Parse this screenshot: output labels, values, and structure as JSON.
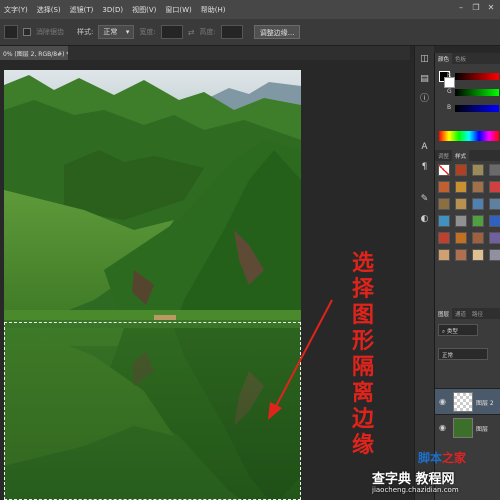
{
  "menubar": {
    "items": [
      "文字(Y)",
      "选择(S)",
      "滤镜(T)",
      "3D(D)",
      "视图(V)",
      "窗口(W)",
      "帮助(H)"
    ]
  },
  "options": {
    "anti_alias_label": "消除锯齿",
    "style_label": "样式:",
    "style_value": "正常",
    "width_label": "宽度:",
    "height_label": "高度:",
    "refine_edge_label": "调整边缘..."
  },
  "document": {
    "tab_label": "0% (图层 2, RGB/8#) *"
  },
  "annotation": {
    "chars": [
      "选",
      "择",
      "图",
      "形",
      "隔",
      "离",
      "边",
      "缘"
    ]
  },
  "panels": {
    "color_tabs": [
      "颜色",
      "色板"
    ],
    "color_channels": [
      "R",
      "G",
      "B"
    ],
    "styles_tabs": [
      "调整",
      "样式"
    ],
    "layers_tabs": [
      "图层",
      "通道",
      "路径"
    ],
    "layers_kind": "类型",
    "layers_blend": "正常",
    "layer_items": [
      {
        "name": "图层 2"
      },
      {
        "name": "图层"
      }
    ]
  },
  "watermark": {
    "site_line1_blue": "脚本",
    "site_line1_red": "之家",
    "site_line2_main": "查字典 教程网",
    "site_line2_url": "jiaocheng.chazidian.com"
  },
  "colors": {
    "annotation_red": "#e0241c",
    "selection_border": "#f0f0f0"
  }
}
